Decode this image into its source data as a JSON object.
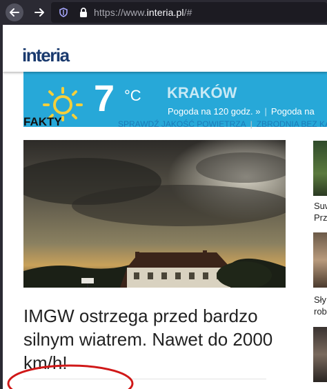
{
  "browser": {
    "url_scheme": "https://www.",
    "url_host": "interia.pl",
    "url_path": "/#",
    "back_icon": "arrow-left-icon",
    "forward_icon": "arrow-right-icon",
    "shield_icon": "tracking-shield-icon",
    "lock_icon": "lock-icon"
  },
  "site": {
    "logo": "interia"
  },
  "weather": {
    "temperature": "7",
    "unit": "°C",
    "city": "KRAKÓW",
    "link_120h": "Pogoda na 120 godz. »",
    "link_more": "Pogoda na"
  },
  "section": {
    "title": "FAKTY",
    "links": [
      "SPRAWDŹ JAKOŚĆ POWIETRZA",
      "ZBRODNIA BEZ KARY"
    ]
  },
  "article": {
    "headline": "IMGW ostrzega przed bardzo silnym wiatrem. Nawet do 2000 km/h!",
    "image_alt": "storm-clouds-over-town-photo"
  },
  "sidebar": {
    "items": [
      {
        "line1": "Suw",
        "line2": "Prz"
      },
      {
        "line1": "Sły",
        "line2": "rob"
      },
      {
        "line1": "",
        "line2": ""
      }
    ]
  },
  "colors": {
    "weather_bg": "#27a8d8",
    "link": "#1e7bb8",
    "annotation": "#d01818"
  }
}
